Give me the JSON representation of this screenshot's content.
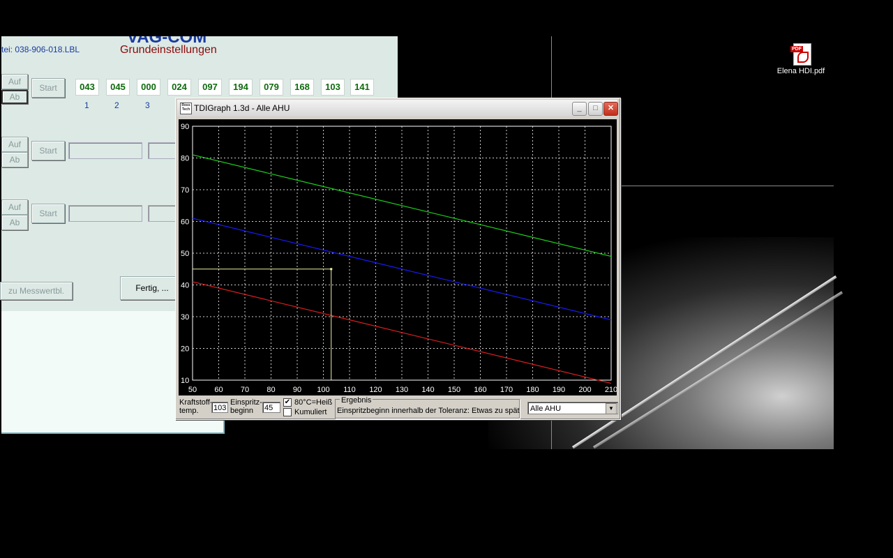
{
  "desktop": {
    "icon": {
      "name": "Elena HDI.pdf",
      "type": "pdf-icon"
    }
  },
  "vcds": {
    "title": "VAG-COM",
    "file_label": "tei:  038-906-018.LBL",
    "heading": "Grundeinstellungen",
    "groups": [
      {
        "up": "Auf",
        "down": "Ab",
        "start": "Start",
        "values": [
          "043",
          "045",
          "000",
          "024",
          "097",
          "194",
          "079",
          "168",
          "103",
          "141"
        ],
        "indices": [
          "1",
          "2",
          "3"
        ]
      },
      {
        "up": "Auf",
        "down": "Ab",
        "start": "Start"
      },
      {
        "up": "Auf",
        "down": "Ab",
        "start": "Start"
      }
    ],
    "back_button": "zu Messwertbl.",
    "done_button": "Fertig, ..."
  },
  "tdigraph": {
    "window_title": "TDIGraph 1.3d - Alle AHU",
    "icon_text": "Ross Tech",
    "footer": {
      "fuel_temp_label_1": "Kraftstoff-",
      "fuel_temp_label_2": "temp.",
      "fuel_temp_value": "103",
      "inj_label_1": "Einspritz-",
      "inj_label_2": "beginn",
      "inj_value": "45",
      "hot_label": "80°C=Heiß",
      "hot_checked": true,
      "cumulative_label": "Kumuliert",
      "cumulative_checked": false,
      "result_title": "Ergebnis",
      "result_text": "Einspritzbeginn innerhalb der Toleranz: Etwas zu spät",
      "profile_selected": "Alle AHU"
    }
  },
  "chart_data": {
    "type": "line",
    "title": "",
    "xlabel": "",
    "ylabel": "",
    "xlim": [
      50,
      210
    ],
    "ylim": [
      10,
      90
    ],
    "xticks": [
      50,
      60,
      70,
      80,
      90,
      100,
      110,
      120,
      130,
      140,
      150,
      160,
      170,
      180,
      190,
      200,
      210
    ],
    "yticks": [
      10,
      20,
      30,
      40,
      50,
      60,
      70,
      80,
      90
    ],
    "grid": true,
    "series": [
      {
        "color": "#1bd41b",
        "x": [
          50,
          210
        ],
        "y": [
          81,
          49
        ]
      },
      {
        "color": "#1a1aff",
        "x": [
          50,
          210
        ],
        "y": [
          61,
          29
        ]
      },
      {
        "color": "#e01e1e",
        "x": [
          50,
          210
        ],
        "y": [
          41,
          9
        ]
      }
    ],
    "marker": {
      "color": "#f0f0a0",
      "x": 103,
      "y": 45
    }
  }
}
